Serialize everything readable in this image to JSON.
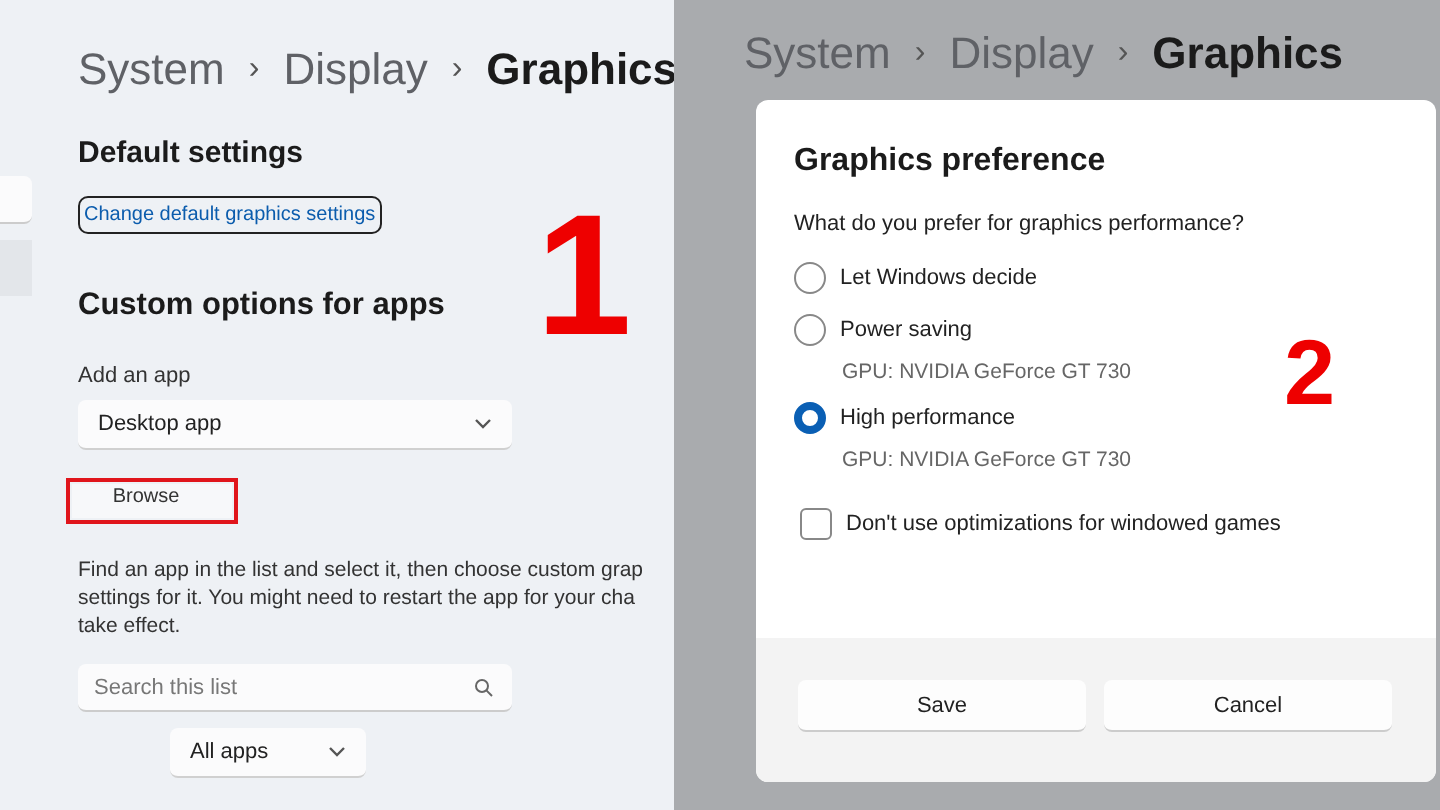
{
  "settings_panel": {
    "breadcrumb": [
      {
        "label": "System",
        "current": false
      },
      {
        "label": "Display",
        "current": false
      },
      {
        "label": "Graphics",
        "current": true
      }
    ],
    "separator": "›",
    "default_settings": {
      "heading": "Default settings",
      "link": "Change default graphics settings"
    },
    "custom_options": {
      "heading": "Custom options for apps",
      "add_label": "Add an app",
      "app_type": "Desktop app",
      "browse": "Browse",
      "help_text": "Find an app in the list and select it, then choose custom grap\nsettings for it. You might need to restart the app for your cha\ntake effect.",
      "search": {
        "placeholder": "Search this list"
      },
      "filter": "All apps"
    },
    "annotation": "1"
  },
  "dialog_view": {
    "breadcrumb": [
      {
        "label": "System",
        "current": false
      },
      {
        "label": "Display",
        "current": false
      },
      {
        "label": "Graphics",
        "current": true
      }
    ],
    "separator": "›",
    "dialog": {
      "title": "Graphics preference",
      "question": "What do you prefer for graphics performance?",
      "options": [
        {
          "label": "Let Windows decide",
          "selected": false
        },
        {
          "label": "Power saving",
          "detail": "GPU: NVIDIA GeForce GT 730",
          "selected": false
        },
        {
          "label": "High performance",
          "detail": "GPU: NVIDIA GeForce GT 730",
          "selected": true
        }
      ],
      "checkbox": {
        "label": "Don't use optimizations for windowed games",
        "checked": false
      },
      "buttons": [
        "Save",
        "Cancel"
      ]
    },
    "annotation": "2"
  }
}
